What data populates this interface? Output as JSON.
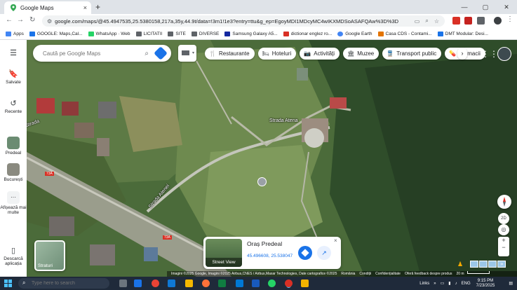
{
  "browser": {
    "tab_title": "Google Maps",
    "tab_close": "×",
    "new_tab": "+",
    "window": {
      "minimize": "—",
      "maximize": "▢",
      "close": "✕"
    },
    "url": "google.com/maps/@45.4947535,25.5380158,217a,35y,44.9t/data=!3m1!1e3?entry=ttu&g_ep=EgoyMDI1MDcyMC4wIKXMDSoASAFQAw%3D%3D",
    "nav": {
      "back": "←",
      "forward": "→",
      "reload": "↻"
    },
    "apps_label": "Apps",
    "bookmarks": [
      {
        "label": "GOOGLE: Maps,Cal...",
        "color": "#1a73e8"
      },
      {
        "label": "WhatsApp · Web",
        "color": "#25d366"
      },
      {
        "label": "LICITATII",
        "color": "#5f6368"
      },
      {
        "label": "SITE",
        "color": "#5f6368"
      },
      {
        "label": "DIVERSE",
        "color": "#5f6368"
      },
      {
        "label": "Samsung Galaxy A5...",
        "color": "#1428a0"
      },
      {
        "label": "dictionar englez ro...",
        "color": "#d93025"
      },
      {
        "label": "Google Earth",
        "color": "#4285f4"
      },
      {
        "label": "Casa CDS - Contami...",
        "color": "#e37400"
      },
      {
        "label": "DMT Modular: Desi...",
        "color": "#1a73e8"
      }
    ]
  },
  "maps": {
    "search_placeholder": "Caută pe Google Maps",
    "categories": [
      {
        "label": "Restaurante",
        "icon": "fork-knife-icon",
        "glyph": "🍴"
      },
      {
        "label": "Hoteluri",
        "icon": "bed-icon",
        "glyph": "🛏"
      },
      {
        "label": "Activități",
        "icon": "camera-icon",
        "glyph": "📷"
      },
      {
        "label": "Muzee",
        "icon": "museum-icon",
        "glyph": "🏛"
      },
      {
        "label": "Transport public",
        "icon": "train-icon",
        "glyph": "🚆"
      },
      {
        "label": "Farmacii",
        "icon": "pharmacy-icon",
        "glyph": "💊"
      }
    ],
    "rail": {
      "menu": "☰",
      "saved": "Salvate",
      "recent": "Recente",
      "recent_places": [
        "Predeal",
        "București"
      ],
      "more": "Afișează mai multe",
      "more_glyph": "···",
      "download": "Descarcă aplicația"
    },
    "map_labels": {
      "street1": "Strada Atena",
      "street2": "Strada Atenei",
      "street3": "Strada",
      "road_badge": "73A"
    },
    "layers_label": "Straturi",
    "info_card": {
      "name": "Oraș Predeal",
      "coords": "45.496608, 25.538047",
      "streetview_label": "Street View",
      "close": "×",
      "share_glyph": "↗"
    },
    "controls": {
      "zoom_in": "+",
      "zoom_out": "−",
      "view_2d": "2D",
      "locate": "◎",
      "apps_glyph": "⋮⋮⋮",
      "expand": "»"
    },
    "attribution": {
      "imagery": "Imagini ©2025 Google, Imagini ©2025 Airbus,CNES / Airbus,Maxar Technologies, Date cartografice ©2025",
      "country": "România",
      "terms": "Condiții",
      "privacy": "Confidențialitate",
      "feedback": "Oferă feedback despre produs",
      "scale": "20 m"
    }
  },
  "taskbar": {
    "search_placeholder": "Type here to search",
    "links": "Links",
    "lang": "ENG",
    "time": "9:15 PM",
    "date": "7/23/2025",
    "app_colors": [
      "#f5b800",
      "#6c757d",
      "#1a73e8",
      "#ea4335",
      "#ff7139",
      "#0078d4",
      "#107c41",
      "#0f78d4",
      "#25d366",
      "#d93025",
      "#f4b400"
    ]
  }
}
